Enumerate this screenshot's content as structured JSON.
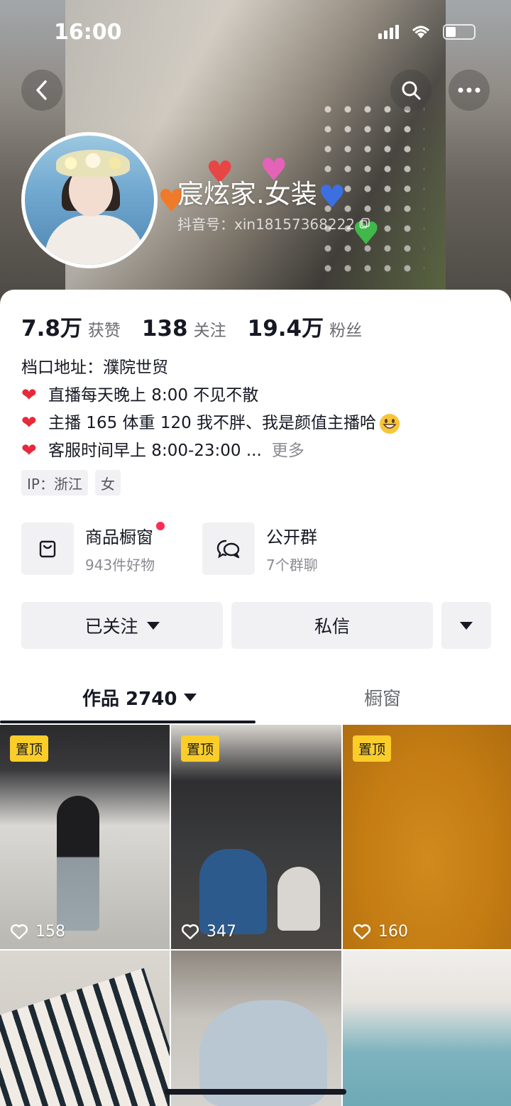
{
  "status_bar": {
    "time": "16:00"
  },
  "profile": {
    "name": "宸炫家.女装",
    "douyin_id": "抖音号：xin18157368222"
  },
  "stats": [
    {
      "value": "7.8万",
      "label": "获赞"
    },
    {
      "value": "138",
      "label": "关注"
    },
    {
      "value": "19.4万",
      "label": "粉丝"
    }
  ],
  "bio": {
    "line1": "档口地址：濮院世贸",
    "line2": "直播每天晚上 8:00 不见不散",
    "line3": "主播 165 体重 120 我不胖、我是颜值主播哈",
    "line4": "客服时间早上 8:00-23:00 ...",
    "more": "更多"
  },
  "tags": [
    "IP：浙江",
    "女"
  ],
  "entries": [
    {
      "title": "商品橱窗",
      "sub": "943件好物"
    },
    {
      "title": "公开群",
      "sub": "7个群聊"
    }
  ],
  "actions": {
    "followed": "已关注",
    "message": "私信"
  },
  "tabs": {
    "works": "作品 2740",
    "window": "橱窗"
  },
  "videos": [
    {
      "pinned": "置顶",
      "likes": "158"
    },
    {
      "pinned": "置顶",
      "likes": "347"
    },
    {
      "pinned": "置顶",
      "likes": "160"
    },
    {
      "pinned": "",
      "likes": ""
    },
    {
      "pinned": "",
      "likes": ""
    },
    {
      "pinned": "",
      "likes": ""
    }
  ],
  "colors": {
    "accent_red": "#fe2c55",
    "pin_yellow": "#facd2a",
    "text_primary": "#161823",
    "text_secondary": "#8a8b91"
  }
}
